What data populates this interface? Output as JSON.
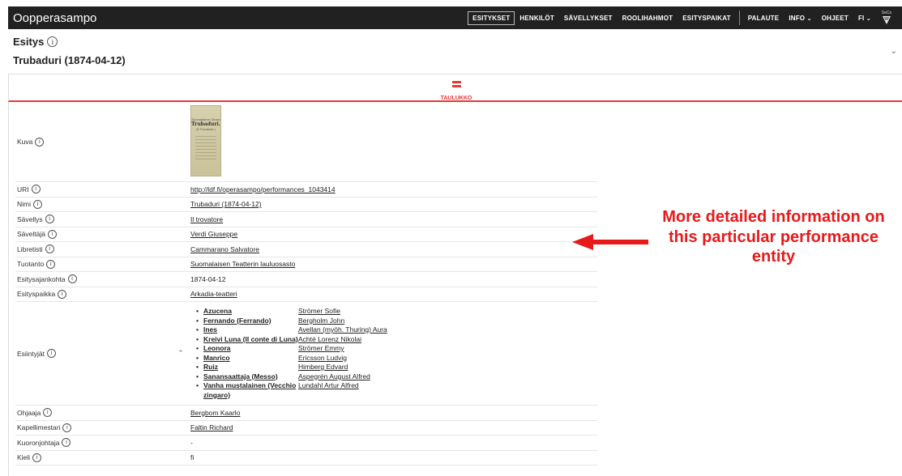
{
  "app": {
    "brand": "Oopperasampo",
    "logo_text": "SeCo"
  },
  "nav": {
    "items": [
      {
        "label": "ESITYKSET",
        "active": true
      },
      {
        "label": "HENKILÖT"
      },
      {
        "label": "SÄVELLYKSET"
      },
      {
        "label": "ROOLIHAHMOT"
      },
      {
        "label": "ESITYSPAIKAT"
      }
    ],
    "right": {
      "feedback": "PALAUTE",
      "info": "INFO",
      "help": "OHJEET",
      "lang": "FI"
    }
  },
  "header": {
    "entity_type": "Esitys",
    "title": "Trubaduri (1874-04-12)"
  },
  "tab": {
    "label": "TAULUKKO",
    "icon": "table-icon"
  },
  "image": {
    "small_text": "Suomalainen Seura",
    "title_text": "Trubaduri.",
    "sub_text": "(Il Trovatore.)"
  },
  "rows": {
    "kuva": "Kuva",
    "uri": {
      "label": "URI",
      "value": "http://ldf.fi/operasampo/performances_1043414"
    },
    "nimi": {
      "label": "Nimi",
      "value": "Trubaduri (1874-04-12)"
    },
    "savellys": {
      "label": "Sävellys",
      "value": "Il trovatore"
    },
    "saveltaja": {
      "label": "Säveltäjä",
      "value": "Verdi Giuseppe"
    },
    "libretisti": {
      "label": "Libretisti",
      "value": "Cammarano Salvatore"
    },
    "tuotanto": {
      "label": "Tuotanto",
      "value": "Suomalaisen Teatterin lauluosasto"
    },
    "ajankohta": {
      "label": "Esitysajankohta",
      "value": "1874-04-12"
    },
    "paikka": {
      "label": "Esityspaikka",
      "value": "Arkadia-teatteri"
    },
    "esiintyjat": {
      "label": "Esiintyjät"
    },
    "ohjaaja": {
      "label": "Ohjaaja",
      "value": "Bergbom Kaarlo"
    },
    "kapellimestari": {
      "label": "Kapellimestari",
      "value": "Faltin Richard"
    },
    "kuoronjohtaja": {
      "label": "Kuoronjohtaja",
      "value": "-"
    },
    "kieli": {
      "label": "Kieli",
      "value": "fi"
    }
  },
  "performers": [
    {
      "role": "Azucena",
      "artist": "Strömer Sofie"
    },
    {
      "role": "Fernando (Ferrando)",
      "artist": "Bergholm John"
    },
    {
      "role": "Ines",
      "artist": "Avellan (myöh. Thuring) Aura"
    },
    {
      "role": "Kreivi Luna (Il conte di Luna)",
      "artist": "Achté Lorenz Nikolai"
    },
    {
      "role": "Leonora",
      "artist": "Strömer Emmy"
    },
    {
      "role": "Manrico",
      "artist": "Ericsson Ludvig"
    },
    {
      "role": "Ruiz",
      "artist": "Himberg Edvard"
    },
    {
      "role": "Sanansaattaja (Messo)",
      "artist": "Aspegrén August Alfred"
    },
    {
      "role": "Vanha mustalainen (Vecchio zingaro)",
      "artist": "Lundahl Artur Alfred"
    }
  ],
  "annotation": {
    "text": "More detailed information on this particular performance entity",
    "color": "#e8191a"
  }
}
